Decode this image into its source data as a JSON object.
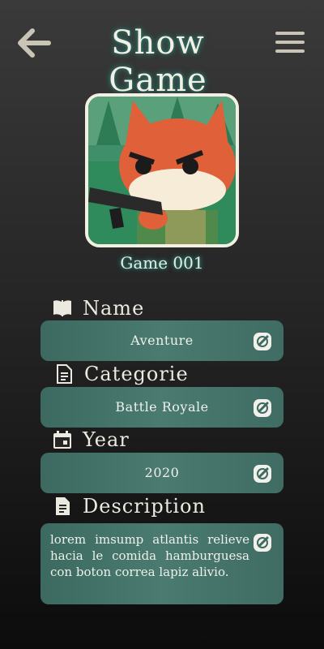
{
  "header": {
    "title": "Show Game",
    "back_icon": "arrow-left-icon",
    "menu_icon": "hamburger-menu-icon"
  },
  "game": {
    "image": "fox-with-gun-cover",
    "id_label": "Game 001"
  },
  "fields": {
    "name": {
      "label": "Name",
      "icon": "book-open-icon",
      "value": "Aventure"
    },
    "category": {
      "label": "Categorie",
      "icon": "document-icon",
      "value": "Battle Royale"
    },
    "year": {
      "label": "Year",
      "icon": "calendar-icon",
      "value": "2020"
    },
    "description": {
      "label": "Description",
      "icon": "document-icon",
      "value": "lorem imsump atlantis relieve hacia le comida hamburguesa con boton correa lapiz alivio."
    }
  },
  "colors": {
    "accent": "#2f6e62",
    "field_bg": "#436f66",
    "text": "#ece9e0"
  }
}
